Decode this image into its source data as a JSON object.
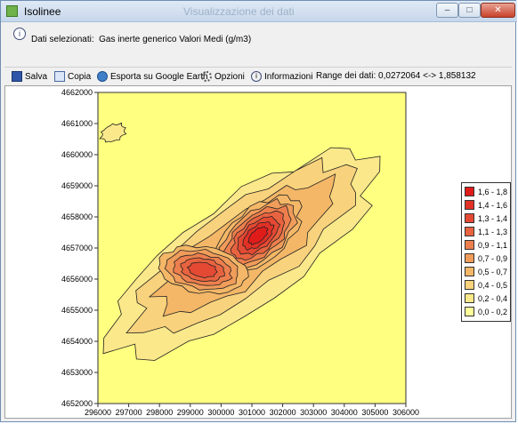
{
  "window": {
    "title": "Isolinee",
    "ghost_title": "Visualizzazione dei dati"
  },
  "header": {
    "label": "Dati selezionati:",
    "value": "Gas inerte generico Valori Medi (g/m3)"
  },
  "toolbar": {
    "save": "Salva",
    "copy": "Copia",
    "export": "Esporta su Google Earth",
    "options": "Opzioni",
    "info": "Informazioni",
    "range": "Range dei dati: 0,0272064 <-> 1,858132"
  },
  "colors": {
    "background": "#ffff80",
    "levels": [
      "#ffff99",
      "#fbe88a",
      "#f8d27c",
      "#f3b767",
      "#f09c5a",
      "#ec7f4d",
      "#e8633f",
      "#e44933",
      "#e23126",
      "#df1c1a"
    ]
  },
  "legend": [
    "1,6 - 1,8",
    "1,4 - 1,6",
    "1,3 - 1,4",
    "1,1 - 1,3",
    "0,9 - 1,1",
    "0,7 - 0,9",
    "0,5 - 0,7",
    "0,4 - 0,5",
    "0,2 - 0,4",
    "0,0 - 0,2"
  ],
  "chart_data": {
    "type": "contour",
    "xlim": [
      296000,
      306000
    ],
    "ylim": [
      4652000,
      4662000
    ],
    "x_ticks": [
      "296000",
      "297000",
      "298000",
      "299000",
      "300000",
      "301000",
      "302000",
      "303000",
      "304000",
      "305000",
      "306000"
    ],
    "y_ticks": [
      "4662000",
      "4661000",
      "4660000",
      "4659000",
      "4658000",
      "4657000",
      "4656000",
      "4655000",
      "4654000",
      "4653000",
      "4652000"
    ],
    "peaks": [
      {
        "x": 301200,
        "y": 4657400,
        "value": 1.85
      },
      {
        "x": 299400,
        "y": 4656300,
        "value": 1.1
      }
    ],
    "grid": false
  }
}
